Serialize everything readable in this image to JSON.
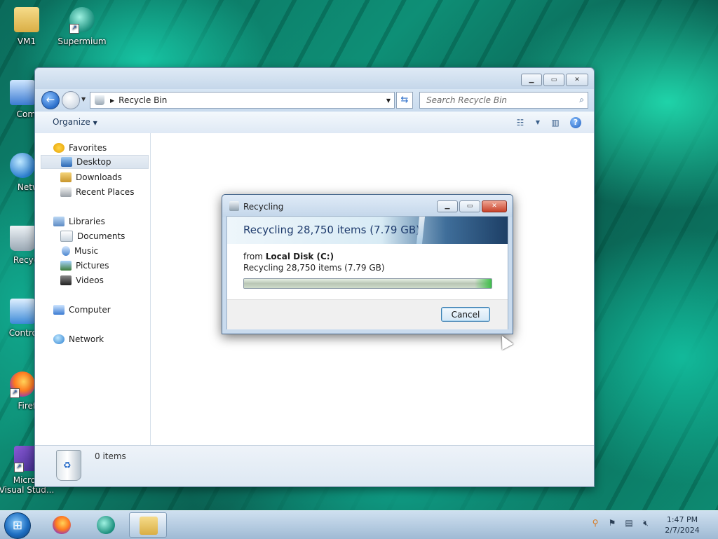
{
  "desktop": {
    "icons": [
      {
        "label": "VM1",
        "icon": "user-folder-icon"
      },
      {
        "label": "Supermium",
        "icon": "supermium-icon"
      },
      {
        "label": "Compu",
        "icon": "computer-icon"
      },
      {
        "label": "Netwo",
        "icon": "network-icon"
      },
      {
        "label": "Recycle",
        "icon": "recycle-bin-icon"
      },
      {
        "label": "Control P",
        "icon": "control-panel-icon"
      },
      {
        "label": "Firefo",
        "icon": "firefox-icon"
      },
      {
        "label": "Micros\nVisual Stud...",
        "icon": "visual-studio-icon"
      }
    ]
  },
  "explorer": {
    "address": "Recycle Bin",
    "search_placeholder": "Search Recycle Bin",
    "organize_label": "Organize",
    "nav": {
      "favorites": "Favorites",
      "desktop": "Desktop",
      "downloads": "Downloads",
      "recent_places": "Recent Places",
      "libraries": "Libraries",
      "documents": "Documents",
      "music": "Music",
      "pictures": "Pictures",
      "videos": "Videos",
      "computer": "Computer",
      "network": "Network"
    },
    "status_count": "0 items"
  },
  "dialog": {
    "title": "Recycling",
    "headline": "Recycling 28,750 items (7.79 GB)",
    "from_prefix": "from ",
    "from_location": "Local Disk (C:)",
    "detail": "Recycling 28,750 items (7.79 GB)",
    "progress": 1.0,
    "cancel_label": "Cancel"
  },
  "taskbar": {
    "apps": [
      "firefox-icon",
      "supermium-icon",
      "windows-explorer-icon"
    ],
    "tray": [
      "search-icon",
      "action-center-flag-icon",
      "network-icon",
      "volume-muted-icon"
    ],
    "time": "1:47 PM",
    "date": "2/7/2024"
  }
}
